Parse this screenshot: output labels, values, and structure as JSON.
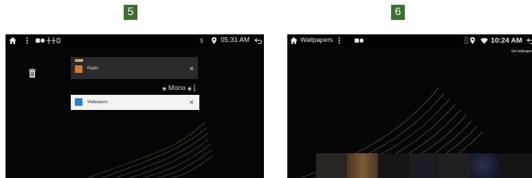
{
  "steps": {
    "left": "5",
    "right": "6"
  },
  "screen5": {
    "status": {
      "time": "05:31 AM"
    },
    "recents": [
      {
        "label": "Radio"
      },
      {
        "label": "Wallpapers"
      }
    ],
    "mono_label": "Mono"
  },
  "screen6": {
    "status": {
      "title": "Wallpapers",
      "time": "10:24 AM"
    },
    "set_wallpaper_label": "Set wallpaper"
  },
  "colors": {
    "step_badge": "#3f6e32",
    "wave": "#c8a85a"
  },
  "icons": [
    "home-icon",
    "more-vert-icon",
    "usb-icon",
    "bluetooth-icon",
    "location-icon",
    "back-icon",
    "trash-icon",
    "close-icon",
    "wifi-icon",
    "phone-icon"
  ]
}
